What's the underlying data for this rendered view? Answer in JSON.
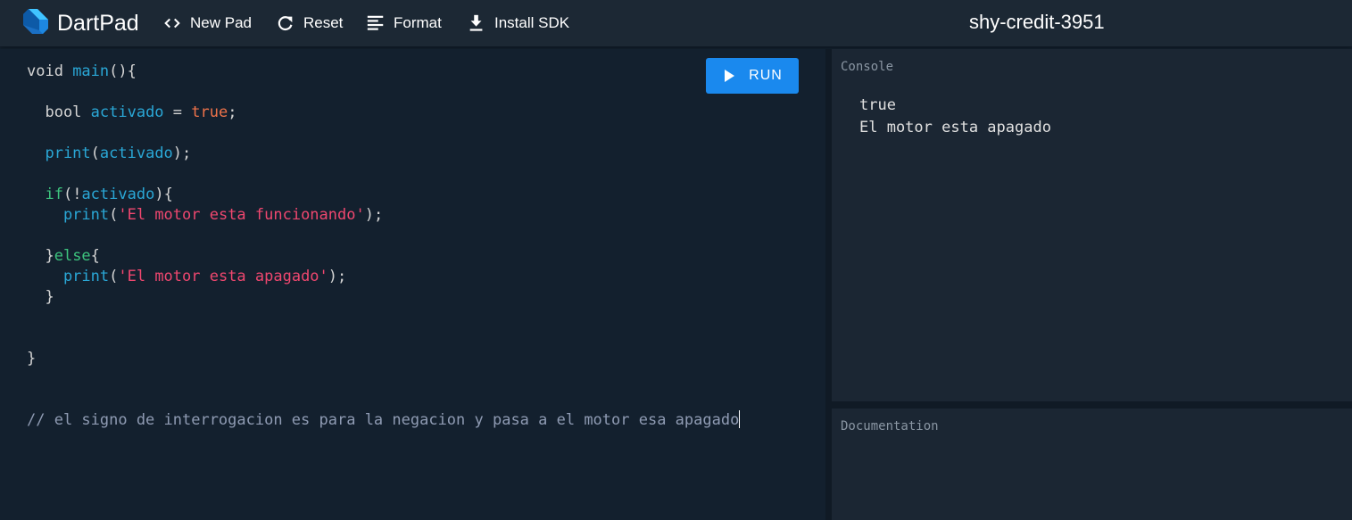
{
  "header": {
    "app_name": "DartPad",
    "pad_name": "shy-credit-3951",
    "tools": [
      {
        "label": "New Pad",
        "icon": "code-icon"
      },
      {
        "label": "Reset",
        "icon": "refresh-icon"
      },
      {
        "label": "Format",
        "icon": "format-align-icon"
      },
      {
        "label": "Install SDK",
        "icon": "download-icon"
      }
    ]
  },
  "editor": {
    "run_label": "RUN",
    "lines": [
      "void main(){",
      "",
      "  bool activado = true;",
      "",
      "  print(activado);",
      "",
      "  if(!activado){",
      "    print('El motor esta funcionando');",
      "",
      "  }else{",
      "    print('El motor esta apagado');",
      "  }",
      "",
      "",
      "}",
      "",
      "",
      "// el signo de interrogacion es para la negacion y pasa a el motor esa apagado"
    ]
  },
  "console": {
    "title": "Console",
    "output": [
      "true",
      "El motor esta apagado"
    ]
  },
  "documentation": {
    "title": "Documentation"
  },
  "colors": {
    "accent": "#1a89ee",
    "function": "#2aa7d6",
    "keyword": "#3dc47e",
    "literal": "#f0734a",
    "string": "#ef476f",
    "comment": "#8f9bb3"
  }
}
